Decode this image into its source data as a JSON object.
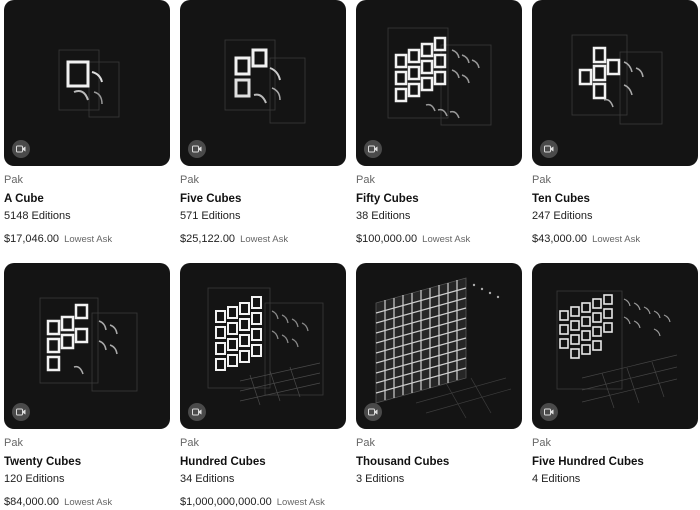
{
  "cards": [
    {
      "artist": "Pak",
      "title": "A Cube",
      "editions": "5148 Editions",
      "price": "$17,046.00",
      "price_label": "Lowest Ask",
      "thumb": "cube-1"
    },
    {
      "artist": "Pak",
      "title": "Five Cubes",
      "editions": "571 Editions",
      "price": "$25,122.00",
      "price_label": "Lowest Ask",
      "thumb": "cube-5"
    },
    {
      "artist": "Pak",
      "title": "Fifty Cubes",
      "editions": "38 Editions",
      "price": "$100,000.00",
      "price_label": "Lowest Ask",
      "thumb": "cube-50"
    },
    {
      "artist": "Pak",
      "title": "Ten Cubes",
      "editions": "247 Editions",
      "price": "$43,000.00",
      "price_label": "Lowest Ask",
      "thumb": "cube-10"
    },
    {
      "artist": "Pak",
      "title": "Twenty Cubes",
      "editions": "120 Editions",
      "price": "$84,000.00",
      "price_label": "Lowest Ask",
      "thumb": "cube-20"
    },
    {
      "artist": "Pak",
      "title": "Hundred Cubes",
      "editions": "34 Editions",
      "price": "$1,000,000,000.00",
      "price_label": "Lowest Ask",
      "thumb": "cube-100"
    },
    {
      "artist": "Pak",
      "title": "Thousand Cubes",
      "editions": "3 Editions",
      "price": "",
      "price_label": "",
      "thumb": "cube-1000"
    },
    {
      "artist": "Pak",
      "title": "Five Hundred Cubes",
      "editions": "4 Editions",
      "price": "",
      "price_label": "",
      "thumb": "cube-500"
    }
  ],
  "video_icon": "video-camera-icon"
}
